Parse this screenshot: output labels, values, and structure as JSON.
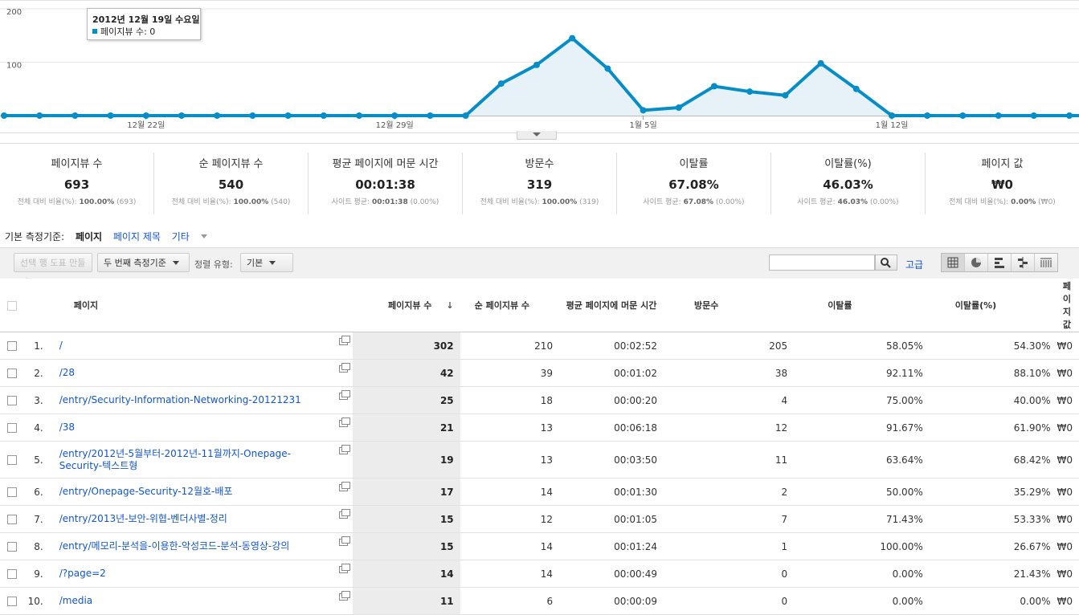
{
  "chart": {
    "y_ticks": [
      "200",
      "100"
    ],
    "x_labels": [
      "12월 22일",
      "12월 29일",
      "1월 5일",
      "1월 12일"
    ],
    "tooltip_date": "2012년 12월 19일 수요일",
    "tooltip_series": "페이지뷰 수: 0",
    "color": "#058dc7"
  },
  "chart_data": {
    "type": "area",
    "series": [
      {
        "name": "페이지뷰 수",
        "values": [
          0,
          0,
          0,
          0,
          0,
          0,
          0,
          0,
          0,
          0,
          0,
          0,
          0,
          0,
          60,
          95,
          145,
          88,
          10,
          15,
          55,
          45,
          38,
          98,
          50,
          0,
          0,
          0,
          0,
          0,
          0,
          0
        ]
      }
    ],
    "ylim": [
      0,
      200
    ],
    "x_tick_labels": [
      "12월 22일",
      "12월 29일",
      "1월 5일",
      "1월 12일"
    ]
  },
  "cards": [
    {
      "label": "페이지뷰 수",
      "value": "693",
      "sub_prefix": "전체 대비 비율(%):",
      "sub_bold": "100.00%",
      "sub_suffix": "(693)"
    },
    {
      "label": "순 페이지뷰 수",
      "value": "540",
      "sub_prefix": "전체 대비 비율(%):",
      "sub_bold": "100.00%",
      "sub_suffix": "(540)"
    },
    {
      "label": "평균 페이지에 머문 시간",
      "value": "00:01:38",
      "sub_prefix": "사이트 평균:",
      "sub_bold": "00:01:38",
      "sub_suffix": "(0.00%)"
    },
    {
      "label": "방문수",
      "value": "319",
      "sub_prefix": "전체 대비 비율(%):",
      "sub_bold": "100.00%",
      "sub_suffix": "(319)"
    },
    {
      "label": "이탈률",
      "value": "67.08%",
      "sub_prefix": "사이트 평균:",
      "sub_bold": "67.08%",
      "sub_suffix": "(0.00%)"
    },
    {
      "label": "이탈률(%)",
      "value": "46.03%",
      "sub_prefix": "사이트 평균:",
      "sub_bold": "46.03%",
      "sub_suffix": "(0.00%)"
    },
    {
      "label": "페이지 값",
      "value": "₩0",
      "sub_prefix": "전체 대비 비율(%):",
      "sub_bold": "0.00%",
      "sub_suffix": "(₩0)"
    }
  ],
  "dimension": {
    "label": "기본 측정기준:",
    "current": "페이지",
    "alt": "페이지 제목",
    "other": "기타"
  },
  "toolbar": {
    "make_chart": "선택 행 도표 만들기",
    "secondary": "두 번째 측정기준",
    "sort_label": "정렬 유형:",
    "sort_value": "기본",
    "search_placeholder": "",
    "advanced": "고급"
  },
  "table": {
    "headers": {
      "page": "페이지",
      "pv": "페이지뷰 수",
      "upv": "순 페이지뷰 수",
      "time": "평균 페이지에 머문 시간",
      "visits": "방문수",
      "bounce": "이탈률",
      "exit": "이탈률(%)",
      "value": "페이지 값",
      "sort_arrow": "↓"
    },
    "rows": [
      {
        "n": "1.",
        "page": "/",
        "pv": "302",
        "upv": "210",
        "time": "00:02:52",
        "visits": "205",
        "bounce": "58.05%",
        "exit": "54.30%",
        "value": "₩0"
      },
      {
        "n": "2.",
        "page": "/28",
        "pv": "42",
        "upv": "39",
        "time": "00:01:02",
        "visits": "38",
        "bounce": "92.11%",
        "exit": "88.10%",
        "value": "₩0"
      },
      {
        "n": "3.",
        "page": "/entry/Security-Information-Networking-20121231",
        "pv": "25",
        "upv": "18",
        "time": "00:00:20",
        "visits": "4",
        "bounce": "75.00%",
        "exit": "40.00%",
        "value": "₩0"
      },
      {
        "n": "4.",
        "page": "/38",
        "pv": "21",
        "upv": "13",
        "time": "00:06:18",
        "visits": "12",
        "bounce": "91.67%",
        "exit": "61.90%",
        "value": "₩0"
      },
      {
        "n": "5.",
        "page": "/entry/2012년-5월부터-2012년-11월까지-Onepage-Security-텍스트형",
        "pv": "19",
        "upv": "13",
        "time": "00:03:50",
        "visits": "11",
        "bounce": "63.64%",
        "exit": "68.42%",
        "value": "₩0"
      },
      {
        "n": "6.",
        "page": "/entry/Onepage-Security-12월호-배포",
        "pv": "17",
        "upv": "14",
        "time": "00:01:30",
        "visits": "2",
        "bounce": "50.00%",
        "exit": "35.29%",
        "value": "₩0"
      },
      {
        "n": "7.",
        "page": "/entry/2013년-보안-위협-벤더사별-정리",
        "pv": "15",
        "upv": "12",
        "time": "00:01:05",
        "visits": "7",
        "bounce": "71.43%",
        "exit": "53.33%",
        "value": "₩0"
      },
      {
        "n": "8.",
        "page": "/entry/메모리-분석을-이용한-악성코드-분석-동영상-강의",
        "pv": "15",
        "upv": "14",
        "time": "00:01:24",
        "visits": "1",
        "bounce": "100.00%",
        "exit": "26.67%",
        "value": "₩0"
      },
      {
        "n": "9.",
        "page": "/?page=2",
        "pv": "14",
        "upv": "14",
        "time": "00:00:49",
        "visits": "0",
        "bounce": "0.00%",
        "exit": "21.43%",
        "value": "₩0"
      },
      {
        "n": "10.",
        "page": "/media",
        "pv": "11",
        "upv": "6",
        "time": "00:00:09",
        "visits": "0",
        "bounce": "0.00%",
        "exit": "0.00%",
        "value": "₩0"
      }
    ]
  }
}
